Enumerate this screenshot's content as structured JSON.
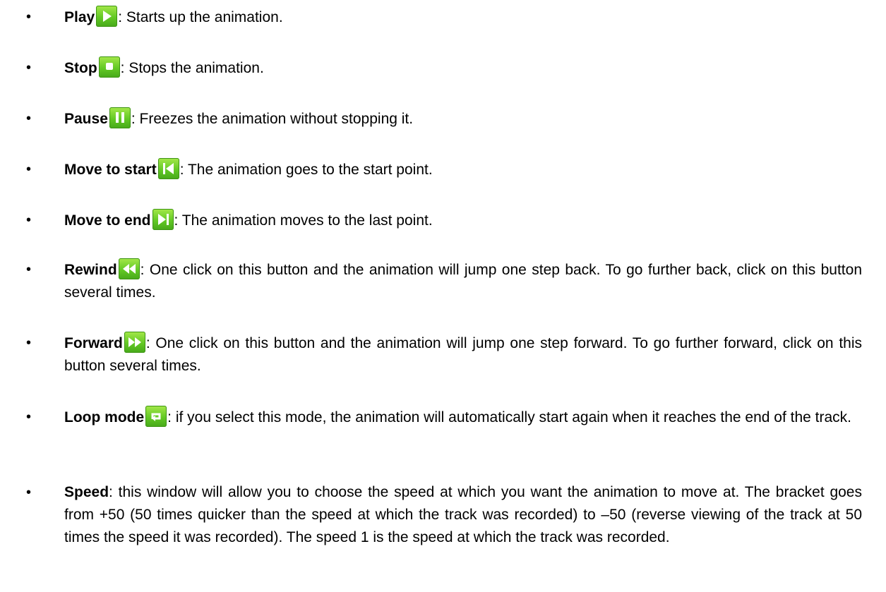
{
  "items": [
    {
      "term": "Play",
      "icon": "play-icon",
      "text": ": Starts up the animation."
    },
    {
      "term": "Stop",
      "icon": "stop-icon",
      "text": ": Stops the animation."
    },
    {
      "term": "Pause",
      "icon": "pause-icon",
      "text": ": Freezes the animation without stopping it."
    },
    {
      "term": "Move to start",
      "icon": "move-to-start-icon",
      "text": ": The animation goes to the start point."
    },
    {
      "term": "Move to end",
      "icon": "move-to-end-icon",
      "text": ": The animation moves to the last point."
    },
    {
      "term": "Rewind",
      "icon": "rewind-icon",
      "text": ": One click on this button and the animation will jump one step back. To go further back, click on this button several times."
    },
    {
      "term": "Forward",
      "icon": "forward-icon",
      "text": ": One click on this button and the animation will jump one step forward. To go further forward, click on this button several times."
    },
    {
      "term": "Loop mode",
      "icon": "loop-mode-icon",
      "text": ": if you select this mode, the animation will automatically start again when it reaches the end of the track."
    },
    {
      "term": "Speed",
      "text": ": this window will allow you to choose the speed at which you want the animation to move at. The bracket goes from +50 (50 times quicker than the speed at which the track was recorded) to –50 (reverse viewing of the track at 50 times the speed it was recorded). The speed 1 is the speed at which the track was recorded."
    }
  ],
  "colors": {
    "icon_green": "#63c925"
  }
}
